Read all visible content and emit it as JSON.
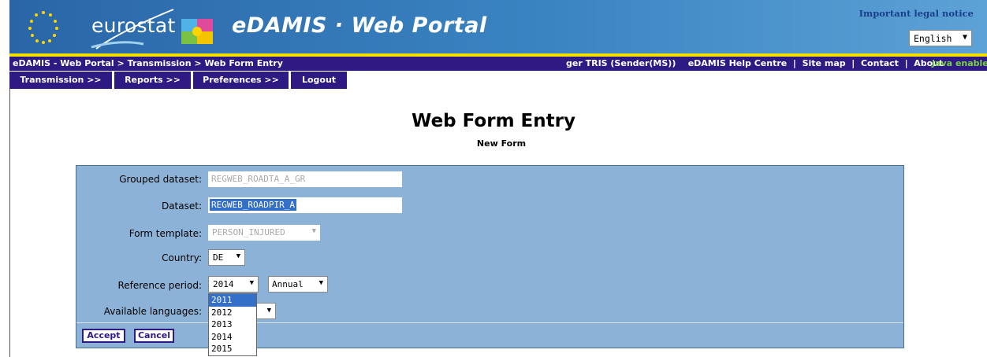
{
  "header": {
    "brand": "eurostat",
    "portal_title": "eDAMIS · Web Portal",
    "legal_link": "Important legal notice",
    "language": "English",
    "colors": {
      "banner": "#3a84c2",
      "accent_line": "#f5e100",
      "nav": "#2f1a84",
      "panel": "#8db2d7"
    }
  },
  "breadcrumb": {
    "path": "eDAMIS - Web Portal > Transmission > Web Form Entry",
    "user": "ger TRIS (Sender(MS))",
    "help": "eDAMIS Help Centre",
    "sitemap": "Site map",
    "contact": "Contact",
    "about": "About",
    "sep": "|",
    "java": "Java enabled"
  },
  "menu": [
    "Transmission >>",
    "Reports >>",
    "Preferences >>",
    "Logout"
  ],
  "page": {
    "title": "Web Form Entry",
    "subtitle": "New Form"
  },
  "form": {
    "grouped_dataset": {
      "label": "Grouped dataset:",
      "value": "REGWEB_ROADTA_A_GR"
    },
    "dataset": {
      "label": "Dataset:",
      "value": "REGWEB_ROADPIR_A"
    },
    "form_template": {
      "label": "Form template:",
      "value": "PERSON_INJURED"
    },
    "country": {
      "label": "Country:",
      "value": "DE"
    },
    "reference_period": {
      "label": "Reference period:",
      "year": "2014",
      "frequency": "Annual",
      "year_options": [
        "2011",
        "2012",
        "2013",
        "2014",
        "2015"
      ],
      "highlighted": "2011"
    },
    "available_languages": {
      "label": "Available languages:"
    },
    "accept": "Accept",
    "cancel": "Cancel"
  }
}
